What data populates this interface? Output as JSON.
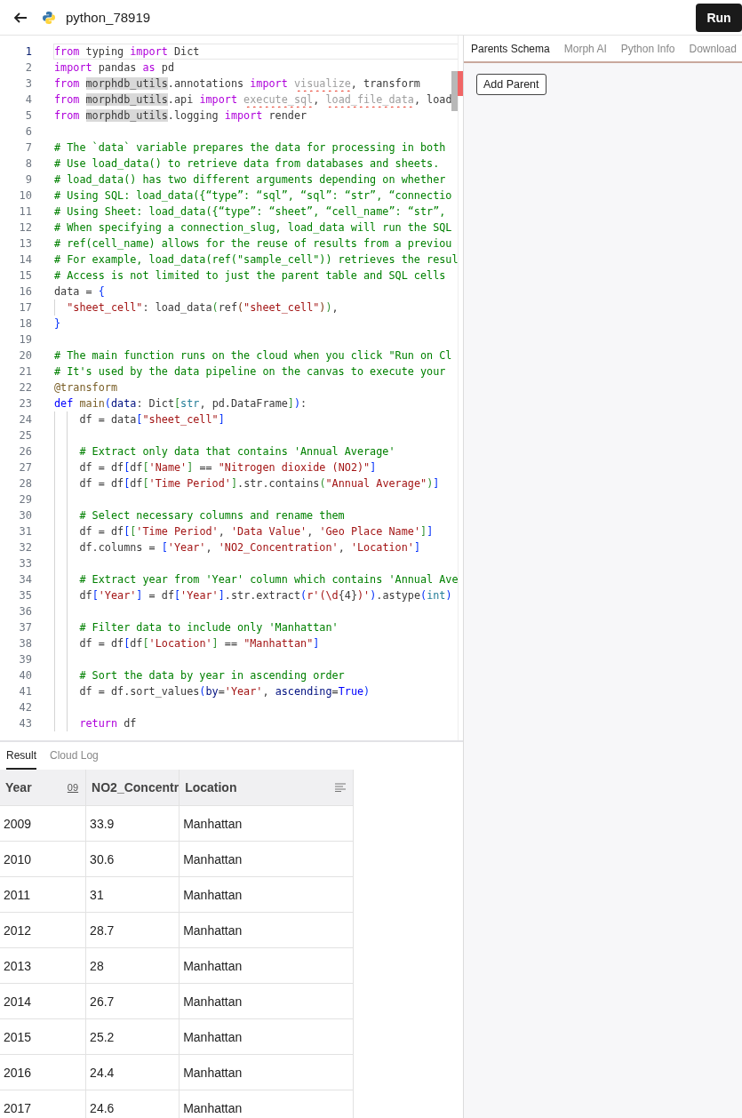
{
  "header": {
    "title": "python_78919",
    "run_button": "Run"
  },
  "editor": {
    "lines": [
      {
        "number": "1",
        "selected": true,
        "tokens": [
          {
            "kind": "kw",
            "text": "from"
          },
          {
            "kind": "plain",
            "text": " typing "
          },
          {
            "kind": "kw",
            "text": "import"
          },
          {
            "kind": "plain",
            "text": " Dict"
          }
        ]
      },
      {
        "number": "2",
        "selected": false,
        "tokens": [
          {
            "kind": "kw",
            "text": "import"
          },
          {
            "kind": "plain",
            "text": " pandas "
          },
          {
            "kind": "kw",
            "text": "as"
          },
          {
            "kind": "plain",
            "text": " pd"
          }
        ]
      },
      {
        "number": "3",
        "selected": false,
        "tokens": [
          {
            "kind": "kw",
            "text": "from "
          },
          {
            "kind": "mod",
            "text": "morphdb_utils"
          },
          {
            "kind": "plain",
            "text": ".annotations "
          },
          {
            "kind": "kw",
            "text": "import "
          },
          {
            "kind": "unused",
            "text": "visualize"
          },
          {
            "kind": "plain",
            "text": ", transform"
          }
        ]
      },
      {
        "number": "4",
        "selected": false,
        "tokens": [
          {
            "kind": "kw",
            "text": "from "
          },
          {
            "kind": "mod",
            "text": "morphdb_utils"
          },
          {
            "kind": "plain",
            "text": ".api "
          },
          {
            "kind": "kw",
            "text": "import "
          },
          {
            "kind": "unused",
            "text": "execute_sql"
          },
          {
            "kind": "plain",
            "text": ", "
          },
          {
            "kind": "unused",
            "text": "load_file_data"
          },
          {
            "kind": "plain",
            "text": ", load"
          }
        ]
      },
      {
        "number": "5",
        "selected": false,
        "tokens": [
          {
            "kind": "kw",
            "text": "from "
          },
          {
            "kind": "mod",
            "text": "morphdb_utils"
          },
          {
            "kind": "plain",
            "text": ".logging "
          },
          {
            "kind": "kw",
            "text": "import"
          },
          {
            "kind": "plain",
            "text": " render"
          }
        ]
      },
      {
        "number": "6",
        "selected": false
      },
      {
        "number": "7",
        "selected": false,
        "tokens": [
          {
            "kind": "comment",
            "text": "# The `data` variable prepares the data for processing in both"
          }
        ]
      },
      {
        "number": "8",
        "selected": false,
        "tokens": [
          {
            "kind": "comment",
            "text": "# Use load_data() to retrieve data from databases and sheets."
          }
        ]
      },
      {
        "number": "9",
        "selected": false,
        "tokens": [
          {
            "kind": "comment",
            "text": "# load_data() has two different arguments depending on whether"
          }
        ]
      },
      {
        "number": "10",
        "selected": false,
        "tokens": [
          {
            "kind": "comment",
            "text": "# Using SQL: load_data({“type”: “sql”, “sql”: “str”, “connectio"
          }
        ]
      },
      {
        "number": "11",
        "selected": false,
        "tokens": [
          {
            "kind": "comment",
            "text": "# Using Sheet: load_data({“type”: “sheet”, “cell_name”: “str”,"
          }
        ]
      },
      {
        "number": "12",
        "selected": false,
        "tokens": [
          {
            "kind": "comment",
            "text": "# When specifying a connection_slug, load_data will run the SQL"
          }
        ]
      },
      {
        "number": "13",
        "selected": false,
        "tokens": [
          {
            "kind": "comment",
            "text": "# ref(cell_name) allows for the reuse of results from a previou"
          }
        ]
      },
      {
        "number": "14",
        "selected": false,
        "tokens": [
          {
            "kind": "comment",
            "text": "# For example, load_data(ref(\"sample_cell\")) retrieves the resul"
          }
        ]
      },
      {
        "number": "15",
        "selected": false,
        "tokens": [
          {
            "kind": "comment",
            "text": "# Access is not limited to just the parent table and SQL cells"
          }
        ]
      },
      {
        "number": "16",
        "selected": false,
        "tokens": [
          {
            "kind": "plain",
            "text": "data = "
          },
          {
            "kind": "bracket",
            "text": "{"
          }
        ]
      },
      {
        "number": "17",
        "selected": false,
        "tokens": [
          {
            "kind": "string",
            "text": "  \"sheet_cell\""
          },
          {
            "kind": "plain",
            "text": ": load_data"
          },
          {
            "kind": "bracket2",
            "text": "("
          },
          {
            "kind": "plain",
            "text": "ref"
          },
          {
            "kind": "bracket3",
            "text": "("
          },
          {
            "kind": "string",
            "text": "\"sheet_cell\""
          },
          {
            "kind": "bracket3",
            "text": ")"
          },
          {
            "kind": "bracket2",
            "text": ")"
          },
          {
            "kind": "plain",
            "text": ","
          }
        ]
      },
      {
        "number": "18",
        "selected": false,
        "tokens": [
          {
            "kind": "bracket",
            "text": "}"
          }
        ]
      },
      {
        "number": "19",
        "selected": false
      },
      {
        "number": "20",
        "selected": false,
        "tokens": [
          {
            "kind": "comment",
            "text": "# The main function runs on the cloud when you click \"Run on Cl"
          }
        ]
      },
      {
        "number": "21",
        "selected": false,
        "tokens": [
          {
            "kind": "comment",
            "text": "# It's used by the data pipeline on the canvas to execute your"
          }
        ]
      },
      {
        "number": "22",
        "selected": false,
        "tokens": [
          {
            "kind": "decorator",
            "text": "@transform"
          }
        ]
      },
      {
        "number": "23",
        "selected": false,
        "tokens": [
          {
            "kind": "def",
            "text": "def "
          },
          {
            "kind": "func",
            "text": "main"
          },
          {
            "kind": "bracket",
            "text": "("
          },
          {
            "kind": "param",
            "text": "data"
          },
          {
            "kind": "plain",
            "text": ": Dict"
          },
          {
            "kind": "bracket2",
            "text": "["
          },
          {
            "kind": "builtin",
            "text": "str"
          },
          {
            "kind": "plain",
            "text": ", pd.DataFrame"
          },
          {
            "kind": "bracket2",
            "text": "]"
          },
          {
            "kind": "bracket",
            "text": ")"
          },
          {
            "kind": "plain",
            "text": ":"
          }
        ]
      },
      {
        "number": "24",
        "selected": false,
        "tokens": [
          {
            "kind": "plain",
            "text": "    df = data"
          },
          {
            "kind": "bracket",
            "text": "["
          },
          {
            "kind": "string",
            "text": "\"sheet_cell\""
          },
          {
            "kind": "bracket",
            "text": "]"
          }
        ]
      },
      {
        "number": "25",
        "selected": false
      },
      {
        "number": "26",
        "selected": false,
        "tokens": [
          {
            "kind": "comment",
            "text": "    # Extract only data that contains 'Annual Average'"
          }
        ]
      },
      {
        "number": "27",
        "selected": false,
        "tokens": [
          {
            "kind": "plain",
            "text": "    df = df"
          },
          {
            "kind": "bracket",
            "text": "["
          },
          {
            "kind": "plain",
            "text": "df"
          },
          {
            "kind": "bracket2",
            "text": "["
          },
          {
            "kind": "string",
            "text": "'Name'"
          },
          {
            "kind": "bracket2",
            "text": "]"
          },
          {
            "kind": "plain",
            "text": " == "
          },
          {
            "kind": "string",
            "text": "\"Nitrogen dioxide (NO2)\""
          },
          {
            "kind": "bracket",
            "text": "]"
          }
        ]
      },
      {
        "number": "28",
        "selected": false,
        "tokens": [
          {
            "kind": "plain",
            "text": "    df = df"
          },
          {
            "kind": "bracket",
            "text": "["
          },
          {
            "kind": "plain",
            "text": "df"
          },
          {
            "kind": "bracket2",
            "text": "["
          },
          {
            "kind": "string",
            "text": "'Time Period'"
          },
          {
            "kind": "bracket2",
            "text": "]"
          },
          {
            "kind": "plain",
            "text": ".str.contains"
          },
          {
            "kind": "bracket2",
            "text": "("
          },
          {
            "kind": "string",
            "text": "\"Annual Average\""
          },
          {
            "kind": "bracket2",
            "text": ")"
          },
          {
            "kind": "bracket",
            "text": "]"
          }
        ]
      },
      {
        "number": "29",
        "selected": false
      },
      {
        "number": "30",
        "selected": false,
        "tokens": [
          {
            "kind": "comment",
            "text": "    # Select necessary columns and rename them"
          }
        ]
      },
      {
        "number": "31",
        "selected": false,
        "tokens": [
          {
            "kind": "plain",
            "text": "    df = df"
          },
          {
            "kind": "bracket",
            "text": "["
          },
          {
            "kind": "bracket2",
            "text": "["
          },
          {
            "kind": "string",
            "text": "'Time Period'"
          },
          {
            "kind": "plain",
            "text": ", "
          },
          {
            "kind": "string",
            "text": "'Data Value'"
          },
          {
            "kind": "plain",
            "text": ", "
          },
          {
            "kind": "string",
            "text": "'Geo Place Name'"
          },
          {
            "kind": "bracket2",
            "text": "]"
          },
          {
            "kind": "bracket",
            "text": "]"
          }
        ]
      },
      {
        "number": "32",
        "selected": false,
        "tokens": [
          {
            "kind": "plain",
            "text": "    df.columns = "
          },
          {
            "kind": "bracket",
            "text": "["
          },
          {
            "kind": "string",
            "text": "'Year'"
          },
          {
            "kind": "plain",
            "text": ", "
          },
          {
            "kind": "string",
            "text": "'NO2_Concentration'"
          },
          {
            "kind": "plain",
            "text": ", "
          },
          {
            "kind": "string",
            "text": "'Location'"
          },
          {
            "kind": "bracket",
            "text": "]"
          }
        ]
      },
      {
        "number": "33",
        "selected": false
      },
      {
        "number": "34",
        "selected": false,
        "tokens": [
          {
            "kind": "comment",
            "text": "    # Extract year from 'Year' column which contains 'Annual Ave"
          }
        ]
      },
      {
        "number": "35",
        "selected": false,
        "tokens": [
          {
            "kind": "plain",
            "text": "    df"
          },
          {
            "kind": "bracket",
            "text": "["
          },
          {
            "kind": "string",
            "text": "'Year'"
          },
          {
            "kind": "bracket",
            "text": "]"
          },
          {
            "kind": "plain",
            "text": " = df"
          },
          {
            "kind": "bracket",
            "text": "["
          },
          {
            "kind": "string",
            "text": "'Year'"
          },
          {
            "kind": "bracket",
            "text": "]"
          },
          {
            "kind": "plain",
            "text": ".str.extract"
          },
          {
            "kind": "bracket",
            "text": "("
          },
          {
            "kind": "string",
            "text": "r'(\\d"
          },
          {
            "kind": "plain",
            "text": "{4}"
          },
          {
            "kind": "string",
            "text": ")'"
          },
          {
            "kind": "bracket",
            "text": ")"
          },
          {
            "kind": "plain",
            "text": ".astype"
          },
          {
            "kind": "bracket",
            "text": "("
          },
          {
            "kind": "builtin",
            "text": "int"
          },
          {
            "kind": "bracket",
            "text": ")"
          }
        ]
      },
      {
        "number": "36",
        "selected": false
      },
      {
        "number": "37",
        "selected": false,
        "tokens": [
          {
            "kind": "comment",
            "text": "    # Filter data to include only 'Manhattan'"
          }
        ]
      },
      {
        "number": "38",
        "selected": false,
        "tokens": [
          {
            "kind": "plain",
            "text": "    df = df"
          },
          {
            "kind": "bracket",
            "text": "["
          },
          {
            "kind": "plain",
            "text": "df"
          },
          {
            "kind": "bracket2",
            "text": "["
          },
          {
            "kind": "string",
            "text": "'Location'"
          },
          {
            "kind": "bracket2",
            "text": "]"
          },
          {
            "kind": "plain",
            "text": " == "
          },
          {
            "kind": "string",
            "text": "\"Manhattan\""
          },
          {
            "kind": "bracket",
            "text": "]"
          }
        ]
      },
      {
        "number": "39",
        "selected": false
      },
      {
        "number": "40",
        "selected": false,
        "tokens": [
          {
            "kind": "comment",
            "text": "    # Sort the data by year in ascending order"
          }
        ]
      },
      {
        "number": "41",
        "selected": false,
        "tokens": [
          {
            "kind": "plain",
            "text": "    df = df.sort_values"
          },
          {
            "kind": "bracket",
            "text": "("
          },
          {
            "kind": "param",
            "text": "by"
          },
          {
            "kind": "plain",
            "text": "="
          },
          {
            "kind": "string",
            "text": "'Year'"
          },
          {
            "kind": "plain",
            "text": ", "
          },
          {
            "kind": "param",
            "text": "ascending"
          },
          {
            "kind": "plain",
            "text": "="
          },
          {
            "kind": "def",
            "text": "True"
          },
          {
            "kind": "bracket",
            "text": ")"
          }
        ]
      },
      {
        "number": "42",
        "selected": false
      },
      {
        "number": "43",
        "selected": false,
        "tokens": [
          {
            "kind": "kw",
            "text": "    return"
          },
          {
            "kind": "plain",
            "text": " df"
          }
        ]
      }
    ]
  },
  "result_tabs": [
    {
      "label": "Result",
      "selected": true
    },
    {
      "label": "Cloud Log",
      "selected": false
    }
  ],
  "table": {
    "columns": [
      {
        "label": "Year",
        "type_badge": "09"
      },
      {
        "label": "NO2_Concentr"
      },
      {
        "label": "Location",
        "kind": "text"
      }
    ],
    "rows": [
      [
        "2009",
        "33.9",
        "Manhattan"
      ],
      [
        "2010",
        "30.6",
        "Manhattan"
      ],
      [
        "2011",
        "31",
        "Manhattan"
      ],
      [
        "2012",
        "28.7",
        "Manhattan"
      ],
      [
        "2013",
        "28",
        "Manhattan"
      ],
      [
        "2014",
        "26.7",
        "Manhattan"
      ],
      [
        "2015",
        "25.2",
        "Manhattan"
      ],
      [
        "2016",
        "24.4",
        "Manhattan"
      ],
      [
        "2017",
        "24.6",
        "Manhattan"
      ]
    ]
  },
  "side_tabs": [
    {
      "label": "Parents Schema",
      "selected": true
    },
    {
      "label": "Morph AI",
      "selected": false
    },
    {
      "label": "Python Info",
      "selected": false
    },
    {
      "label": "Download",
      "selected": false
    }
  ],
  "add_parent_button": "Add Parent"
}
